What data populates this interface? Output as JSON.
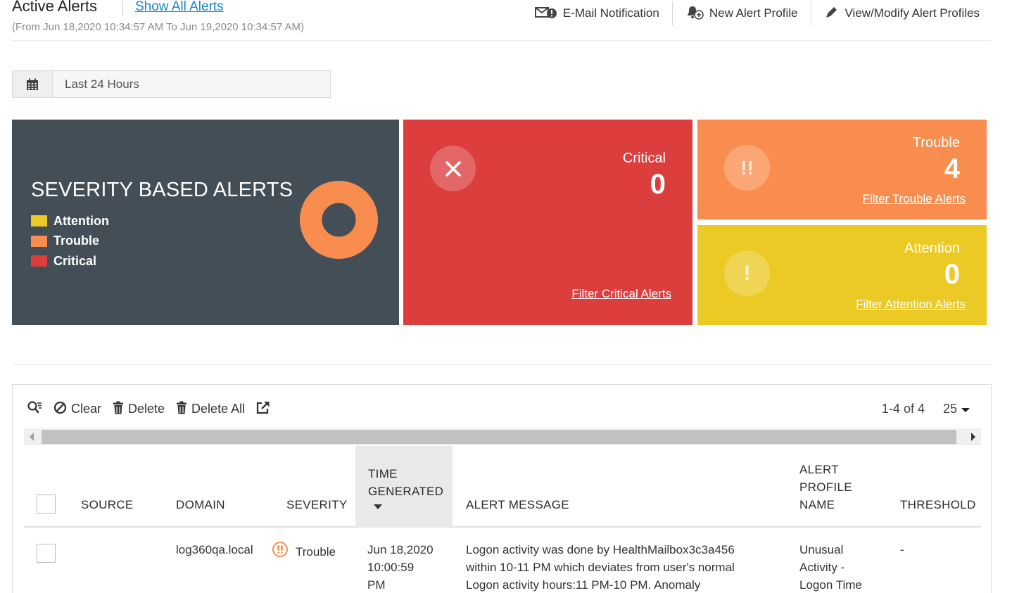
{
  "header": {
    "title": "Active Alerts",
    "show_all_link": "Show All Alerts",
    "range": "(From Jun 18,2020 10:34:57 AM To Jun 19,2020 10:34:57 AM)",
    "actions": [
      {
        "label": "E-Mail Notification",
        "icon": "email-alert-icon"
      },
      {
        "label": "New Alert Profile",
        "icon": "new-alert-profile-icon"
      },
      {
        "label": "View/Modify Alert Profiles",
        "icon": "pencil-icon"
      }
    ]
  },
  "date_filter": {
    "label": "Last 24 Hours",
    "icon": "calendar-icon"
  },
  "severity_panel": {
    "title": "SEVERITY BASED ALERTS",
    "legend": [
      {
        "label": "Attention",
        "color": "#ecca25"
      },
      {
        "label": "Trouble",
        "color": "#f98d4f"
      },
      {
        "label": "Critical",
        "color": "#dc3d3d"
      }
    ]
  },
  "chart_data": {
    "type": "pie",
    "categories": [
      "Attention",
      "Trouble",
      "Critical"
    ],
    "values": [
      0,
      4,
      0
    ],
    "colors": [
      "#ecca25",
      "#f98d4f",
      "#dc3d3d"
    ],
    "title": "",
    "legend_position": "left"
  },
  "cards": {
    "critical": {
      "label": "Critical",
      "count": "0",
      "link": "Filter Critical Alerts",
      "icon": "x-icon",
      "color": "#dc3d3d"
    },
    "trouble": {
      "label": "Trouble",
      "count": "4",
      "link": "Filter Trouble Alerts",
      "icon": "double-exclamation-icon",
      "color": "#f98d4f"
    },
    "attention": {
      "label": "Attention",
      "count": "0",
      "link": "Filter Attention Alerts",
      "icon": "exclamation-icon",
      "color": "#ecca25"
    }
  },
  "toolbar": {
    "clear": "Clear",
    "delete": "Delete",
    "delete_all": "Delete All"
  },
  "pager": {
    "range": "1-4 of 4",
    "page_size": "25"
  },
  "table": {
    "columns": {
      "source": "SOURCE",
      "domain": "DOMAIN",
      "severity": "SEVERITY",
      "time_1": "TIME",
      "time_2": "GENERATED",
      "message": "ALERT MESSAGE",
      "profile_1": "ALERT",
      "profile_2": "PROFILE",
      "profile_3": "NAME",
      "threshold": "THRESHOLD"
    },
    "rows": [
      {
        "source": "",
        "domain": "log360qa.local",
        "severity": "Trouble",
        "time_1": "Jun 18,2020",
        "time_2": "10:00:59",
        "time_3": "PM",
        "message_1": "Logon activity was done by HealthMailbox3c3a456",
        "message_2": "within 10-11 PM which deviates from user's normal",
        "message_3": "Logon activity hours:11 PM-10 PM. Anomaly",
        "profile_1": "Unusual",
        "profile_2": "Activity -",
        "profile_3": "Logon Time",
        "threshold": "-"
      }
    ]
  }
}
